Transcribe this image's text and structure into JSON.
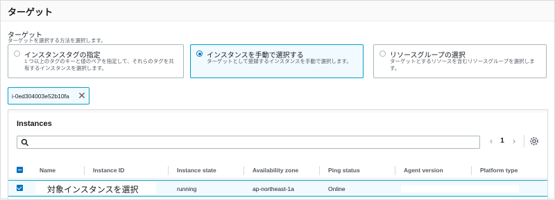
{
  "header": {
    "title": "ターゲット"
  },
  "target_field": {
    "label": "ターゲット",
    "description": "ターゲットを選択する方法を選択します。"
  },
  "tiles": [
    {
      "title": "インスタンスタグの指定",
      "description": "1 つ以上のタグのキーと値のペアを指定して、それらのタグを共有するインスタンスを選択します。",
      "selected": false
    },
    {
      "title": "インスタンスを手動で選択する",
      "description": "ターゲットとして登録するインスタンスを手動で選択します。",
      "selected": true
    },
    {
      "title": "リソースグループの選択",
      "description": "ターゲットとするリソースを含むリソースグループを選択します。",
      "selected": false
    }
  ],
  "token": {
    "label": "i-0ed304003e52b10fa"
  },
  "instances": {
    "title": "Instances",
    "search_placeholder": "",
    "pagination": {
      "current_page": "1"
    },
    "columns": [
      "Name",
      "Instance ID",
      "Instance state",
      "Availability zone",
      "Ping status",
      "Agent version",
      "Platform type"
    ],
    "rows": [
      {
        "name": "対象インスタンスを選択",
        "instance_state": "running",
        "availability_zone": "ap-northeast-1a",
        "ping_status": "Online",
        "selected": true
      }
    ]
  },
  "colors": {
    "accent": "#0073bb",
    "selected_border": "#00a1c9",
    "selected_bg": "#f1faff"
  }
}
